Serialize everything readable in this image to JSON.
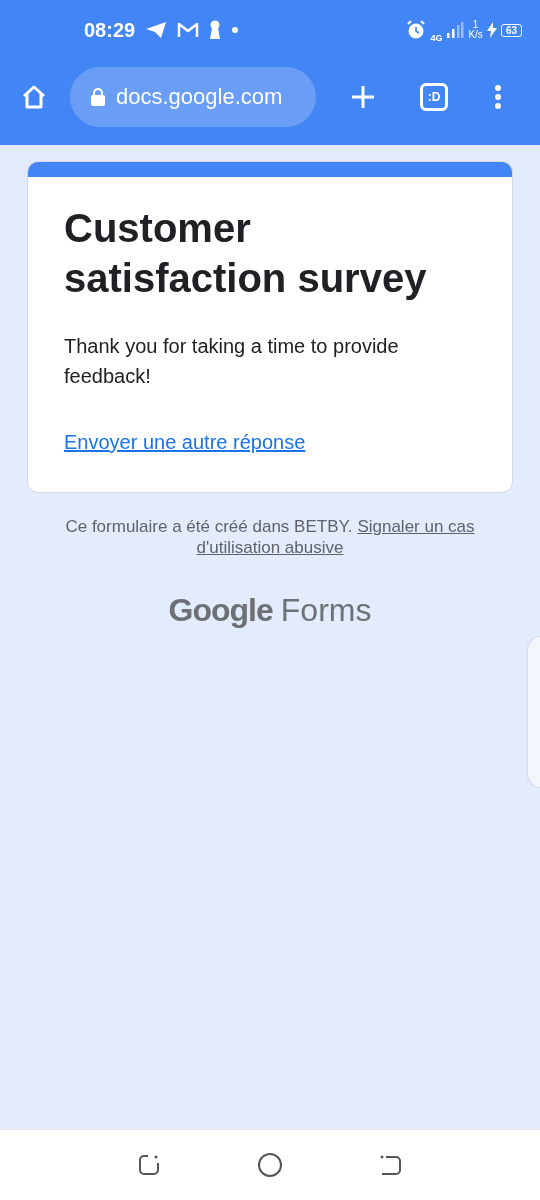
{
  "status_bar": {
    "time": "08:29",
    "network": "4G",
    "speed_value": "1",
    "speed_unit": "K/s",
    "battery": "63",
    "charging": true
  },
  "browser": {
    "url": "docs.google.com",
    "tab_count": ":D"
  },
  "form": {
    "title": "Customer satisfaction survey",
    "message": "Thank you for taking a time to provide feedback!",
    "link": "Envoyer une autre réponse"
  },
  "footer": {
    "text": "Ce formulaire a été créé dans BETBY.",
    "link_lines": [
      "Signaler un cas",
      "d'utilisation abusive"
    ]
  },
  "logo": {
    "brand": "Google",
    "product": "Forms"
  }
}
